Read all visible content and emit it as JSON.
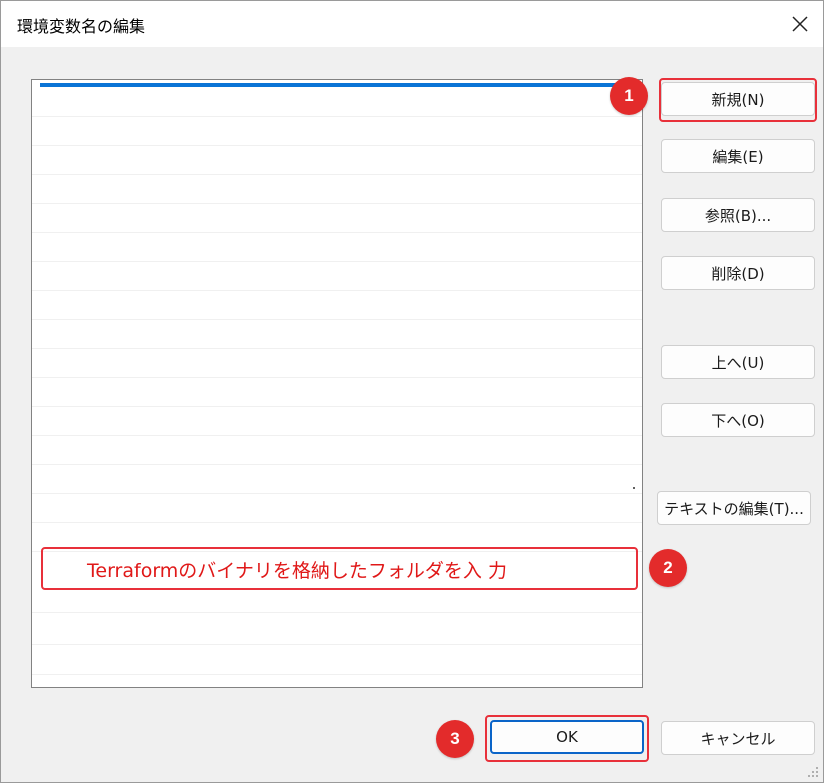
{
  "window": {
    "title": "環境変数名の編集",
    "close_glyph": "✕"
  },
  "buttons": {
    "new": "新規(N)",
    "edit": "編集(E)",
    "browse": "参照(B)...",
    "delete": "削除(D)",
    "move_up": "上へ(U)",
    "move_down": "下へ(O)",
    "edit_text": "テキストの編集(T)...",
    "ok": "OK",
    "cancel": "キャンセル"
  },
  "annotations": {
    "badge_1": "1",
    "badge_2": "2",
    "badge_3": "3",
    "instruction": "Terraformのバイナリを格納したフォルダを入 力"
  },
  "colors": {
    "accent": "#0a74d6",
    "annotation_red": "#e32b2b"
  }
}
